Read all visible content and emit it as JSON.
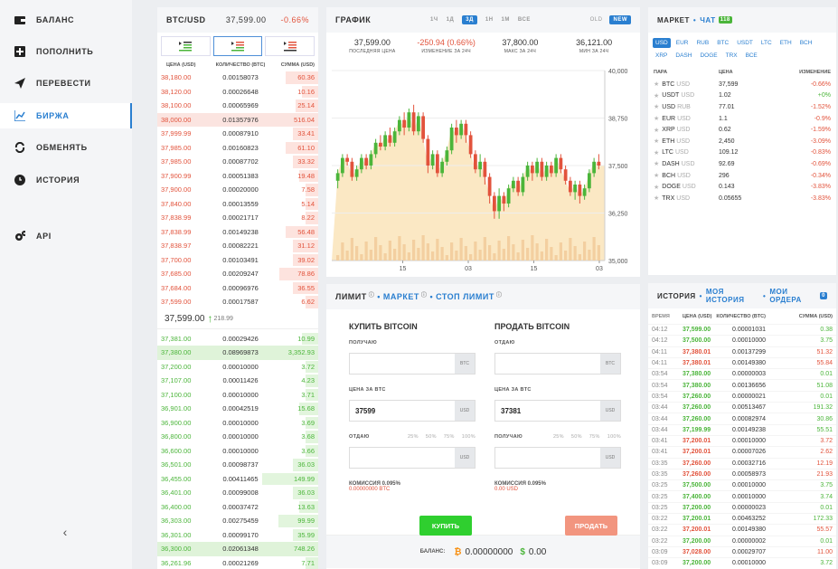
{
  "sidebar": {
    "items": [
      {
        "key": "balance",
        "label": "БАЛАНС",
        "icon": "wallet-icon"
      },
      {
        "key": "deposit",
        "label": "ПОПОЛНИТЬ",
        "icon": "plus-icon"
      },
      {
        "key": "transfer",
        "label": "ПЕРЕВЕСТИ",
        "icon": "send-icon"
      },
      {
        "key": "exchange",
        "label": "БИРЖА",
        "icon": "chart-icon",
        "active": true
      },
      {
        "key": "swap",
        "label": "ОБМЕНЯТЬ",
        "icon": "swap-icon"
      },
      {
        "key": "history",
        "label": "ИСТОРИЯ",
        "icon": "clock-icon"
      },
      {
        "key": "api",
        "label": "API",
        "icon": "gears-icon"
      }
    ]
  },
  "orderbook": {
    "pair": "BTC/USD",
    "price": "37,599.00",
    "change": "-0.66%",
    "headers": [
      "ЦЕНА (USD)",
      "КОЛИЧЕСТВО (BTC)",
      "СУММА (USD)"
    ],
    "asks": [
      {
        "p": "38,180.00",
        "q": "0.00158073",
        "s": "60.36",
        "w": 0.2
      },
      {
        "p": "38,120.00",
        "q": "0.00026648",
        "s": "10.16",
        "w": 0.1
      },
      {
        "p": "38,100.00",
        "q": "0.00065969",
        "s": "25.14",
        "w": 0.14
      },
      {
        "p": "38,000.00",
        "q": "0.01357976",
        "s": "516.04",
        "w": 1
      },
      {
        "p": "37,999.99",
        "q": "0.00087910",
        "s": "33.41",
        "w": 0.16
      },
      {
        "p": "37,985.00",
        "q": "0.00160823",
        "s": "61.10",
        "w": 0.2
      },
      {
        "p": "37,985.00",
        "q": "0.00087702",
        "s": "33.32",
        "w": 0.16
      },
      {
        "p": "37,900.99",
        "q": "0.00051383",
        "s": "19.48",
        "w": 0.12
      },
      {
        "p": "37,900.00",
        "q": "0.00020000",
        "s": "7.58",
        "w": 0.08
      },
      {
        "p": "37,840.00",
        "q": "0.00013559",
        "s": "5.14",
        "w": 0.08
      },
      {
        "p": "37,838.99",
        "q": "0.00021717",
        "s": "8.22",
        "w": 0.08
      },
      {
        "p": "37,838.99",
        "q": "0.00149238",
        "s": "56.48",
        "w": 0.2
      },
      {
        "p": "37,838.97",
        "q": "0.00082221",
        "s": "31.12",
        "w": 0.16
      },
      {
        "p": "37,700.00",
        "q": "0.00103491",
        "s": "39.02",
        "w": 0.16
      },
      {
        "p": "37,685.00",
        "q": "0.00209247",
        "s": "78.86",
        "w": 0.24
      },
      {
        "p": "37,684.00",
        "q": "0.00096976",
        "s": "36.55",
        "w": 0.16
      },
      {
        "p": "37,599.00",
        "q": "0.00017587",
        "s": "6.62",
        "w": 0.08
      }
    ],
    "mid": {
      "price": "37,599.00",
      "arrow": "↑",
      "diff": "218.99"
    },
    "bids": [
      {
        "p": "37,381.00",
        "q": "0.00029426",
        "s": "10.99",
        "w": 0.1
      },
      {
        "p": "37,380.00",
        "q": "0.08969873",
        "s": "3,352.93",
        "w": 1
      },
      {
        "p": "37,200.00",
        "q": "0.00010000",
        "s": "3.72",
        "w": 0.08
      },
      {
        "p": "37,107.00",
        "q": "0.00011426",
        "s": "4.23",
        "w": 0.08
      },
      {
        "p": "37,100.00",
        "q": "0.00010000",
        "s": "3.71",
        "w": 0.08
      },
      {
        "p": "36,901.00",
        "q": "0.00042519",
        "s": "15.68",
        "w": 0.12
      },
      {
        "p": "36,900.00",
        "q": "0.00010000",
        "s": "3.69",
        "w": 0.08
      },
      {
        "p": "36,800.00",
        "q": "0.00010000",
        "s": "3.68",
        "w": 0.08
      },
      {
        "p": "36,600.00",
        "q": "0.00010000",
        "s": "3.66",
        "w": 0.08
      },
      {
        "p": "36,501.00",
        "q": "0.00098737",
        "s": "36.03",
        "w": 0.16
      },
      {
        "p": "36,455.00",
        "q": "0.00411465",
        "s": "149.99",
        "w": 0.35
      },
      {
        "p": "36,401.00",
        "q": "0.00099008",
        "s": "36.03",
        "w": 0.16
      },
      {
        "p": "36,400.00",
        "q": "0.00037472",
        "s": "13.63",
        "w": 0.12
      },
      {
        "p": "36,303.00",
        "q": "0.00275459",
        "s": "99.99",
        "w": 0.25
      },
      {
        "p": "36,301.00",
        "q": "0.00099170",
        "s": "35.99",
        "w": 0.16
      },
      {
        "p": "36,300.00",
        "q": "0.02061348",
        "s": "748.26",
        "w": 1
      },
      {
        "p": "36,261.96",
        "q": "0.00021269",
        "s": "7.71",
        "w": 0.08
      }
    ]
  },
  "chart": {
    "title": "ГРАФИК",
    "timeframes": [
      "1Ч",
      "1Д",
      "3Д",
      "1Н",
      "1М",
      "ВСЕ"
    ],
    "selected": "3Д",
    "old": "OLD",
    "new": "NEW",
    "stats": [
      {
        "v": "37,599.00",
        "l": "ПОСЛЕДНЯЯ ЦЕНА"
      },
      {
        "v": "-250.94 (0.66%)",
        "l": "ИЗМЕНЕНИЕ ЗА 24Ч",
        "neg": true
      },
      {
        "v": "37,800.00",
        "l": "МАКС ЗА 24Ч"
      },
      {
        "v": "36,121.00",
        "l": "МИН ЗА 24Ч"
      }
    ]
  },
  "chart_data": {
    "type": "candlestick",
    "y_ticks": [
      "40,000",
      "38,750",
      "37,500",
      "36,250",
      "35,000"
    ],
    "ylim": [
      35000,
      40000
    ],
    "x_ticks": [
      "15",
      "03",
      "15",
      "03"
    ],
    "candles": [
      [
        37100,
        37300,
        36900,
        37400
      ],
      [
        37300,
        37700,
        37200,
        37800
      ],
      [
        37700,
        37600,
        37500,
        37800
      ],
      [
        37600,
        37200,
        37100,
        37700
      ],
      [
        37200,
        37400,
        37100,
        37500
      ],
      [
        37400,
        37700,
        37300,
        37800
      ],
      [
        37700,
        37500,
        37400,
        37800
      ],
      [
        37500,
        37800,
        37400,
        37900
      ],
      [
        37800,
        38100,
        37700,
        38200
      ],
      [
        38100,
        38000,
        37900,
        38300
      ],
      [
        38000,
        38300,
        37900,
        38400
      ],
      [
        38300,
        38100,
        38000,
        38500
      ],
      [
        38100,
        38400,
        38000,
        38500
      ],
      [
        38400,
        38700,
        38300,
        38800
      ],
      [
        38700,
        38500,
        38300,
        38900
      ],
      [
        38500,
        38900,
        38400,
        39000
      ],
      [
        38900,
        38400,
        38300,
        39100
      ],
      [
        38400,
        38800,
        38300,
        38900
      ],
      [
        38800,
        38200,
        38100,
        38900
      ],
      [
        38200,
        37500,
        37300,
        38300
      ],
      [
        37500,
        37800,
        37400,
        37900
      ],
      [
        37800,
        37300,
        37200,
        37900
      ],
      [
        37300,
        37600,
        37200,
        37700
      ],
      [
        37600,
        37900,
        37500,
        38000
      ],
      [
        37900,
        38500,
        37800,
        38600
      ],
      [
        38500,
        38300,
        38100,
        38700
      ],
      [
        38300,
        38600,
        38200,
        38700
      ],
      [
        38600,
        38300,
        38100,
        38700
      ],
      [
        38300,
        37800,
        37700,
        38400
      ],
      [
        37800,
        37400,
        37300,
        37900
      ],
      [
        37400,
        37600,
        37200,
        37800
      ],
      [
        37600,
        37200,
        37000,
        37700
      ],
      [
        37200,
        36700,
        36500,
        37300
      ],
      [
        36700,
        36300,
        36100,
        36800
      ],
      [
        36300,
        36700,
        36100,
        36900
      ],
      [
        36700,
        36500,
        36300,
        36800
      ],
      [
        36500,
        36900,
        36400,
        37000
      ],
      [
        36900,
        37100,
        36800,
        37200
      ],
      [
        37100,
        36800,
        36700,
        37200
      ],
      [
        36800,
        37200,
        36700,
        37300
      ],
      [
        37200,
        37500,
        37100,
        37600
      ],
      [
        37500,
        37300,
        37100,
        37600
      ],
      [
        37300,
        37600,
        37200,
        37700
      ],
      [
        37600,
        37200,
        37100,
        37700
      ],
      [
        37200,
        37500,
        37100,
        37600
      ],
      [
        37500,
        37300,
        37200,
        37600
      ],
      [
        37300,
        37700,
        37200,
        37800
      ],
      [
        37700,
        37400,
        37300,
        37800
      ],
      [
        37400,
        37100,
        37000,
        37500
      ],
      [
        37100,
        36800,
        36700,
        37200
      ],
      [
        36800,
        37000,
        36600,
        37100
      ],
      [
        37000,
        36700,
        36500,
        37100
      ],
      [
        36700,
        36900,
        36600,
        37000
      ],
      [
        36900,
        37300,
        36800,
        37400
      ],
      [
        37300,
        37600,
        37200,
        37700
      ],
      [
        37600,
        37500,
        37400,
        37800
      ]
    ]
  },
  "trade": {
    "tabs": [
      "ЛИМИТ",
      "МАРКЕТ",
      "СТОП ЛИМИТ"
    ],
    "buy": {
      "title": "КУПИТЬ BITCOIN",
      "receive_label": "ПОЛУЧАЮ",
      "receive_unit": "BTC",
      "price_label": "ЦЕНА ЗА BTC",
      "price_value": "37599",
      "price_unit": "USD",
      "give_label": "ОТДАЮ",
      "give_unit": "USD",
      "commission_label": "КОМИССИЯ 0.095%",
      "commission_value": "0.00000000 BTC",
      "button": "КУПИТЬ"
    },
    "sell": {
      "title": "ПРОДАТЬ BITCOIN",
      "give_label": "ОТДАЮ",
      "give_unit": "BTC",
      "price_label": "ЦЕНА ЗА BTC",
      "price_value": "37381",
      "price_unit": "USD",
      "receive_label": "ПОЛУЧАЮ",
      "receive_unit": "USD",
      "commission_label": "КОМИССИЯ 0.095%",
      "commission_value": "0.00 USD",
      "button": "ПРОДАТЬ"
    },
    "percents": [
      "25%",
      "50%",
      "75%",
      "100%"
    ],
    "balance": {
      "label": "БАЛАНС:",
      "btc": "0.00000000",
      "usd": "0.00"
    }
  },
  "market": {
    "title": "МАРКЕТ",
    "chat": "ЧАТ",
    "chat_badge": "118",
    "tabs": [
      "USD",
      "EUR",
      "RUB",
      "BTC",
      "USDT",
      "LTC",
      "ETH",
      "BCH",
      "XRP",
      "DASH",
      "DOGE",
      "TRX",
      "ВСЕ"
    ],
    "selected": "USD",
    "headers": [
      "ПАРА",
      "ЦЕНА",
      "ИЗМЕНЕНИЕ"
    ],
    "rows": [
      {
        "b": "BTC",
        "q": "USD",
        "price": "37,599",
        "ch": "-0.66%",
        "neg": true
      },
      {
        "b": "USDT",
        "q": "USD",
        "price": "1.02",
        "ch": "+0%",
        "neg": false
      },
      {
        "b": "USD",
        "q": "RUB",
        "price": "77.01",
        "ch": "-1.52%",
        "neg": true
      },
      {
        "b": "EUR",
        "q": "USD",
        "price": "1.1",
        "ch": "-0.9%",
        "neg": true
      },
      {
        "b": "XRP",
        "q": "USD",
        "price": "0.62",
        "ch": "-1.59%",
        "neg": true
      },
      {
        "b": "ETH",
        "q": "USD",
        "price": "2,450",
        "ch": "-3.09%",
        "neg": true
      },
      {
        "b": "LTC",
        "q": "USD",
        "price": "109.12",
        "ch": "-0.83%",
        "neg": true
      },
      {
        "b": "DASH",
        "q": "USD",
        "price": "92.69",
        "ch": "-0.69%",
        "neg": true
      },
      {
        "b": "BCH",
        "q": "USD",
        "price": "296",
        "ch": "-0.34%",
        "neg": true
      },
      {
        "b": "DOGE",
        "q": "USD",
        "price": "0.143",
        "ch": "-3.83%",
        "neg": true
      },
      {
        "b": "TRX",
        "q": "USD",
        "price": "0.05655",
        "ch": "-3.83%",
        "neg": true
      }
    ]
  },
  "history": {
    "title": "ИСТОРИЯ",
    "mine": "МОЯ ИСТОРИЯ",
    "orders": "МОИ ОРДЕРА",
    "orders_badge": "0",
    "headers": [
      "ВРЕМЯ",
      "ЦЕНА (USD)",
      "КОЛИЧЕСТВО (BTC)",
      "СУММА (USD)"
    ],
    "rows": [
      {
        "t": "04:12",
        "p": "37,599.00",
        "a": "0.00001031",
        "s": "0.38",
        "buy": true
      },
      {
        "t": "04:12",
        "p": "37,500.00",
        "a": "0.00010000",
        "s": "3.75",
        "buy": true
      },
      {
        "t": "04:11",
        "p": "37,380.01",
        "a": "0.00137299",
        "s": "51.32",
        "buy": false
      },
      {
        "t": "04:11",
        "p": "37,380.01",
        "a": "0.00149380",
        "s": "55.84",
        "buy": false
      },
      {
        "t": "03:54",
        "p": "37,380.00",
        "a": "0.00000003",
        "s": "0.01",
        "buy": true
      },
      {
        "t": "03:54",
        "p": "37,380.00",
        "a": "0.00136656",
        "s": "51.08",
        "buy": true
      },
      {
        "t": "03:54",
        "p": "37,260.00",
        "a": "0.00000021",
        "s": "0.01",
        "buy": true
      },
      {
        "t": "03:44",
        "p": "37,260.00",
        "a": "0.00513467",
        "s": "191.32",
        "buy": true
      },
      {
        "t": "03:44",
        "p": "37,260.00",
        "a": "0.00082974",
        "s": "30.86",
        "buy": true
      },
      {
        "t": "03:44",
        "p": "37,199.99",
        "a": "0.00149238",
        "s": "55.51",
        "buy": true
      },
      {
        "t": "03:41",
        "p": "37,200.01",
        "a": "0.00010000",
        "s": "3.72",
        "buy": false
      },
      {
        "t": "03:41",
        "p": "37,200.01",
        "a": "0.00007026",
        "s": "2.62",
        "buy": false
      },
      {
        "t": "03:35",
        "p": "37,260.00",
        "a": "0.00032716",
        "s": "12.19",
        "buy": false
      },
      {
        "t": "03:35",
        "p": "37,260.00",
        "a": "0.00058973",
        "s": "21.93",
        "buy": false
      },
      {
        "t": "03:25",
        "p": "37,500.00",
        "a": "0.00010000",
        "s": "3.75",
        "buy": true
      },
      {
        "t": "03:25",
        "p": "37,400.00",
        "a": "0.00010000",
        "s": "3.74",
        "buy": true
      },
      {
        "t": "03:25",
        "p": "37,200.00",
        "a": "0.00000023",
        "s": "0.01",
        "buy": true
      },
      {
        "t": "03:22",
        "p": "37,200.01",
        "a": "0.00463252",
        "s": "172.33",
        "buy": true
      },
      {
        "t": "03:22",
        "p": "37,200.01",
        "a": "0.00149380",
        "s": "55.57",
        "buy": false
      },
      {
        "t": "03:22",
        "p": "37,200.00",
        "a": "0.00000002",
        "s": "0.01",
        "buy": true
      },
      {
        "t": "03:09",
        "p": "37,028.00",
        "a": "0.00029707",
        "s": "11.00",
        "buy": false
      },
      {
        "t": "03:09",
        "p": "37,200.00",
        "a": "0.00010000",
        "s": "3.72",
        "buy": true
      }
    ]
  },
  "colors": {
    "accent": "#2a7fd0",
    "buy": "#4bb53a",
    "sell": "#e2533c",
    "buy_button": "#2fcf2f",
    "sell_button": "#f2957f"
  }
}
